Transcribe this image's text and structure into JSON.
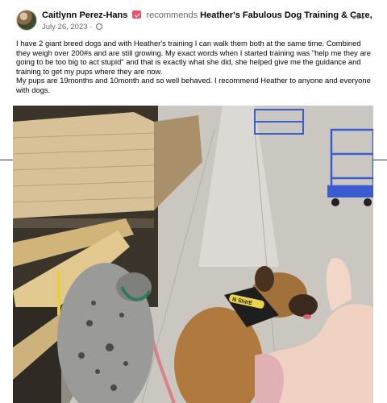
{
  "post": {
    "author": "Caitlynn Perez-Hans",
    "action": "recommends",
    "page": "Heather's Fabulous Dog Training & Care, LLC.",
    "date": "July 26, 2023",
    "date_separator": "·",
    "more_label": "•••",
    "body": [
      "I have 2 giant breed dogs and with Heather's training I can walk them both at the same time. Combined they weigh over 200#s and are still growing. My exact words when I started training was \"help me they are going to be too big to act stupid\" and that is exactly what she did, she helped give me the guidance and training to get my pups where they are now.",
      "My pups are 19months and 10month and so well behaved. I recommend Heather to anyone and everyone with dogs."
    ],
    "collar_text": "N ShIrE"
  },
  "colors": {
    "rec_badge": "#f25268",
    "text_primary": "#050505",
    "text_secondary": "#65676b",
    "floor": "#c8c6bf",
    "lumber": "#d7bf92",
    "cart_blue": "#3b5bd1"
  },
  "icons": {
    "recommend": "recommend-icon",
    "privacy": "globe-icon",
    "more": "more-options-icon"
  }
}
